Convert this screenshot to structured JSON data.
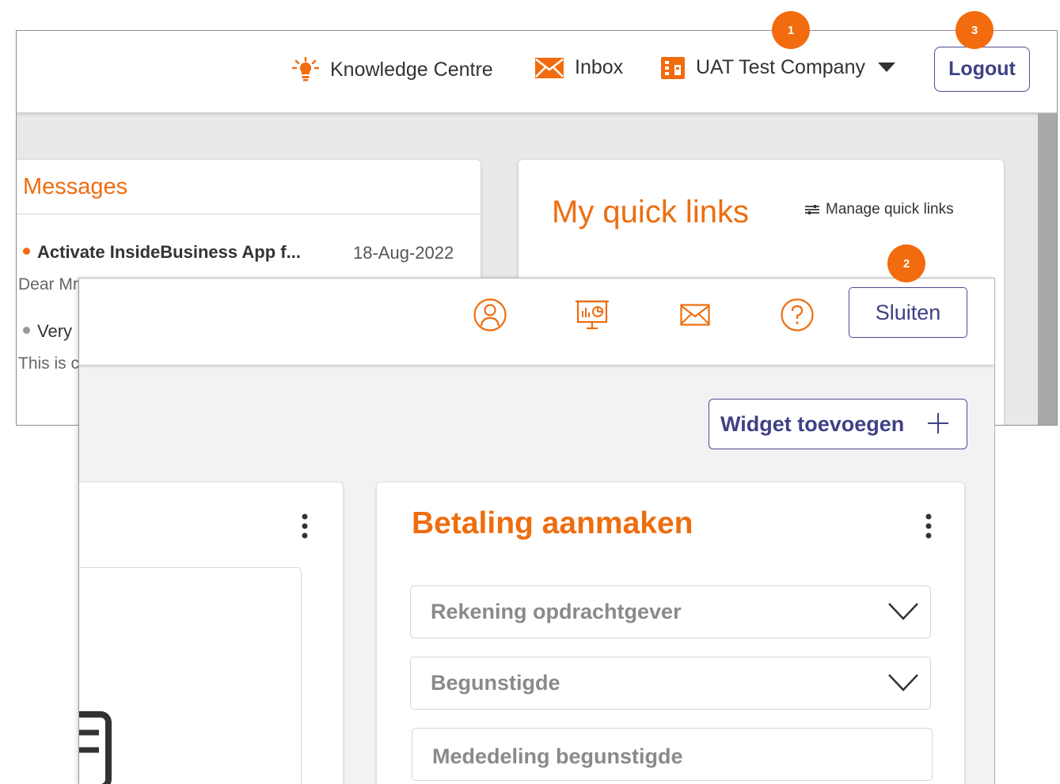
{
  "header": {
    "knowledge_centre": "Knowledge Centre",
    "inbox": "Inbox",
    "company": "UAT Test Company",
    "logout": "Logout"
  },
  "messages": {
    "title": "Messages",
    "items": [
      {
        "title": "Activate InsideBusiness App f...",
        "date": "18-Aug-2022",
        "preview": "Dear Mr",
        "status_color": "#f26b0e"
      },
      {
        "title": "Very",
        "preview": "This is c",
        "status_color": "#999999"
      }
    ]
  },
  "quick_links": {
    "title": "My quick links",
    "manage": "Manage quick links"
  },
  "callouts": [
    "1",
    "2",
    "3"
  ],
  "front": {
    "close": "Sluiten",
    "add_widget": "Widget toevoegen",
    "icons": [
      "user-icon",
      "dashboard-icon",
      "mail-icon",
      "help-icon"
    ]
  },
  "payment": {
    "title": "Betaling aanmaken",
    "fields": [
      {
        "label": "Rekening opdrachtgever"
      },
      {
        "label": "Begunstigde"
      },
      {
        "label": "Mededeling begunstigde"
      }
    ]
  },
  "colors": {
    "accent": "#ee6d0f",
    "brand_blue": "#3f4184",
    "badge": "#f26b0e"
  }
}
